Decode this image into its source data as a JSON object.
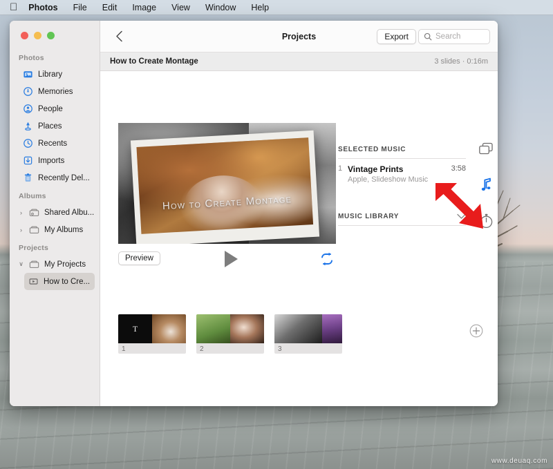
{
  "menubar": {
    "apple_glyph": "",
    "items": [
      {
        "label": "Photos",
        "bold": true
      },
      {
        "label": "File"
      },
      {
        "label": "Edit"
      },
      {
        "label": "Image"
      },
      {
        "label": "View"
      },
      {
        "label": "Window"
      },
      {
        "label": "Help"
      }
    ]
  },
  "window": {
    "traffic_lights": [
      "close",
      "minimize",
      "zoom"
    ]
  },
  "sidebar": {
    "groups": [
      {
        "title": "Photos",
        "items": [
          {
            "label": "Library",
            "icon": "library-icon"
          },
          {
            "label": "Memories",
            "icon": "memories-icon"
          },
          {
            "label": "People",
            "icon": "people-icon"
          },
          {
            "label": "Places",
            "icon": "places-icon"
          },
          {
            "label": "Recents",
            "icon": "recents-icon"
          },
          {
            "label": "Imports",
            "icon": "imports-icon"
          },
          {
            "label": "Recently Del...",
            "icon": "trash-icon"
          }
        ]
      },
      {
        "title": "Albums",
        "items": [
          {
            "label": "Shared Albu...",
            "icon": "shared-album-icon",
            "twisty": "›"
          },
          {
            "label": "My Albums",
            "icon": "album-icon",
            "twisty": "›"
          }
        ]
      },
      {
        "title": "Projects",
        "items": [
          {
            "label": "My Projects",
            "icon": "folder-icon",
            "twisty": "∨"
          },
          {
            "label": "How to Cre...",
            "icon": "slideshow-icon",
            "selected": true
          }
        ]
      }
    ]
  },
  "toolbar": {
    "back_label": "‹",
    "title": "Projects",
    "export_label": "Export",
    "search_placeholder": "Search"
  },
  "subbar": {
    "project_name": "How to Create Montage",
    "meta": "3 slides · 0:16m"
  },
  "preview": {
    "overlay_title": "How to Create Montage",
    "preview_button": "Preview",
    "play_icon": "play-icon",
    "loop_icon": "loop-repeat-icon"
  },
  "music": {
    "selected_heading": "SELECTED MUSIC",
    "tracks": [
      {
        "number": "1",
        "title": "Vintage Prints",
        "subtitle": "Apple, Slideshow Music",
        "duration": "3:58"
      }
    ],
    "library_heading": "MUSIC LIBRARY",
    "library_chevron": "∨"
  },
  "rail": {
    "buttons": [
      {
        "icon": "slides-cards-icon",
        "active": false
      },
      {
        "icon": "music-note-icon",
        "active": true,
        "color": "#1a73e8"
      },
      {
        "icon": "duration-timer-icon",
        "active": false
      }
    ]
  },
  "filmstrip": {
    "slides": [
      {
        "index": "1",
        "kind": "title-slide"
      },
      {
        "index": "2",
        "kind": "photo-slide"
      },
      {
        "index": "3",
        "kind": "photo-slide"
      }
    ],
    "add_label": "+"
  },
  "annotation": {
    "arrow_color": "#e81c1c",
    "points_to": "music-note-icon"
  },
  "watermark": "www.deuaq.com",
  "colors": {
    "accent_blue": "#1a73e8",
    "sidebar_bg": "#eceaea",
    "window_bg": "#ffffff",
    "selection": "#d6d2cf"
  }
}
